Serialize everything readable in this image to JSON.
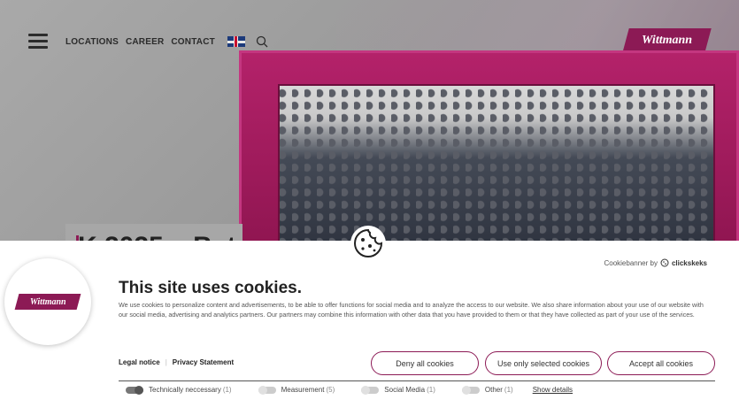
{
  "nav": {
    "links": [
      "LOCATIONS",
      "CAREER",
      "CONTACT"
    ],
    "language_icon": "uk-flag-icon",
    "search_icon": "search-icon"
  },
  "brand": {
    "logo_text": "Wittmann",
    "accent": "#8c1a55"
  },
  "hero": {
    "title": "K 2025 – Bat"
  },
  "cookie_banner": {
    "powered_by": "Cookiebanner by",
    "powered_brand": "clickskeks",
    "title": "This site uses cookies.",
    "description": "We use cookies to personalize content and advertisements, to be able to offer functions for social media and to analyze the access to our website. We also share information about your use of our website with our social media, advertising and analytics partners. Our partners may combine this information with other data that you have provided to them or that they have collected as part of your use of the services.",
    "legal_notice": "Legal notice",
    "separator": "|",
    "privacy_statement": "Privacy Statement",
    "buttons": {
      "deny": "Deny all cookies",
      "selected": "Use only selected cookies",
      "accept": "Accept all cookies"
    },
    "categories": [
      {
        "label": "Technically neccessary",
        "count": "(1)",
        "on": true
      },
      {
        "label": "Measurement",
        "count": "(5)",
        "on": false
      },
      {
        "label": "Social Media",
        "count": "(1)",
        "on": false
      },
      {
        "label": "Other",
        "count": "(1)",
        "on": false
      }
    ],
    "show_details": "Show details"
  }
}
